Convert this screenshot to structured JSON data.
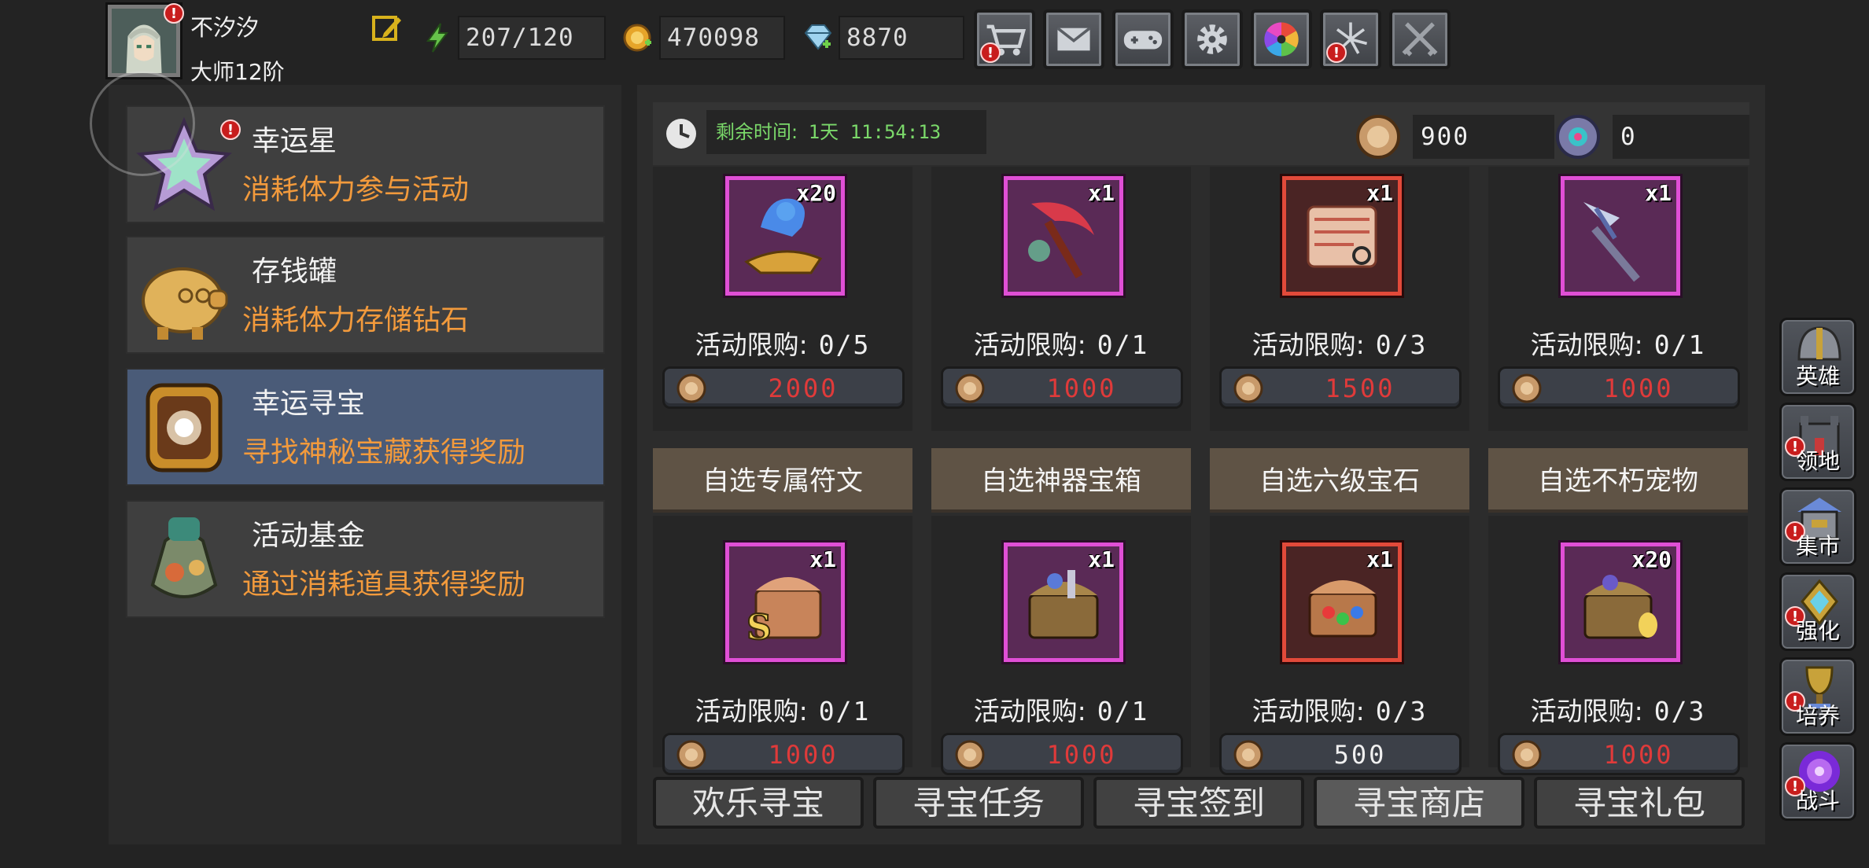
{
  "player": {
    "name": "不汐汐",
    "rank": "大师12阶"
  },
  "resources": [
    {
      "icon": "stamina-icon",
      "value": "207/120"
    },
    {
      "icon": "gold-coin-icon",
      "value": "470098"
    },
    {
      "icon": "diamond-icon",
      "value": "8870"
    }
  ],
  "top_buttons": [
    {
      "icon": "shop-cart-icon",
      "alert": true
    },
    {
      "icon": "mail-icon",
      "alert": false
    },
    {
      "icon": "gamepad-icon",
      "alert": false
    },
    {
      "icon": "gear-icon",
      "alert": false
    },
    {
      "icon": "color-wheel-icon",
      "alert": false
    },
    {
      "icon": "fireworks-icon",
      "alert": true
    },
    {
      "icon": "crossed-swords-icon",
      "alert": false
    }
  ],
  "events": [
    {
      "title": "幸运星",
      "desc": "消耗体力参与活动",
      "icon": "lucky-star-icon",
      "alert": true,
      "selected": false
    },
    {
      "title": "存钱罐",
      "desc": "消耗体力存储钻石",
      "icon": "piggy-bank-icon",
      "alert": false,
      "selected": false
    },
    {
      "title": "幸运寻宝",
      "desc": "寻找神秘宝藏获得奖励",
      "icon": "treasure-compass-icon",
      "alert": false,
      "selected": true
    },
    {
      "title": "活动基金",
      "desc": "通过消耗道具获得奖励",
      "icon": "fund-bag-icon",
      "alert": false,
      "selected": false
    }
  ],
  "timer": {
    "label": "剩余时间:",
    "value": "1天 11:54:13"
  },
  "currency": {
    "coin": "900",
    "orb": "0"
  },
  "shop_row1": [
    {
      "name": "genie-lamp-icon",
      "qty": "x20",
      "limit_label": "活动限购:",
      "limit": "0/5",
      "price": "2000",
      "frame": "purple"
    },
    {
      "name": "crimson-scythe-icon",
      "qty": "x1",
      "limit_label": "活动限购:",
      "limit": "0/1",
      "price": "1000",
      "frame": "purple"
    },
    {
      "name": "rune-scroll-icon",
      "qty": "x1",
      "limit_label": "活动限购:",
      "limit": "0/3",
      "price": "1500",
      "frame": "red"
    },
    {
      "name": "crystal-spear-icon",
      "qty": "x1",
      "limit_label": "活动限购:",
      "limit": "0/1",
      "price": "1000",
      "frame": "purple"
    }
  ],
  "categories": [
    "自选专属符文",
    "自选神器宝箱",
    "自选六级宝石",
    "自选不朽宠物"
  ],
  "shop_row2": [
    {
      "name": "rune-chest-icon",
      "qty": "x1",
      "limit_label": "活动限购:",
      "limit": "0/1",
      "price": "1000",
      "frame": "purple",
      "price_color": "#e03a3a"
    },
    {
      "name": "artifact-chest-icon",
      "qty": "x1",
      "limit_label": "活动限购:",
      "limit": "0/1",
      "price": "1000",
      "frame": "purple",
      "price_color": "#e03a3a"
    },
    {
      "name": "gem-chest-icon",
      "qty": "x1",
      "limit_label": "活动限购:",
      "limit": "0/3",
      "price": "500",
      "frame": "red",
      "price_color": "#f0f0f0"
    },
    {
      "name": "pet-chest-icon",
      "qty": "x20",
      "limit_label": "活动限购:",
      "limit": "0/3",
      "price": "1000",
      "frame": "purple",
      "price_color": "#e03a3a"
    }
  ],
  "tabs": [
    {
      "label": "欢乐寻宝",
      "active": false
    },
    {
      "label": "寻宝任务",
      "active": false
    },
    {
      "label": "寻宝签到",
      "active": false
    },
    {
      "label": "寻宝商店",
      "active": true
    },
    {
      "label": "寻宝礼包",
      "active": false
    }
  ],
  "side_menu": [
    {
      "label": "英雄",
      "icon": "helmet-icon",
      "alert": false
    },
    {
      "label": "领地",
      "icon": "castle-icon",
      "alert": true
    },
    {
      "label": "集市",
      "icon": "market-icon",
      "alert": true
    },
    {
      "label": "强化",
      "icon": "upgrade-crystal-icon",
      "alert": true
    },
    {
      "label": "培养",
      "icon": "trophy-icon",
      "alert": true
    },
    {
      "label": "战斗",
      "icon": "portal-icon",
      "alert": true
    }
  ],
  "colors": {
    "accent_orange": "#f29a3c",
    "price_red": "#e03a3a",
    "timer_green": "#7bd96a",
    "selected_blue": "#4a5b78"
  }
}
